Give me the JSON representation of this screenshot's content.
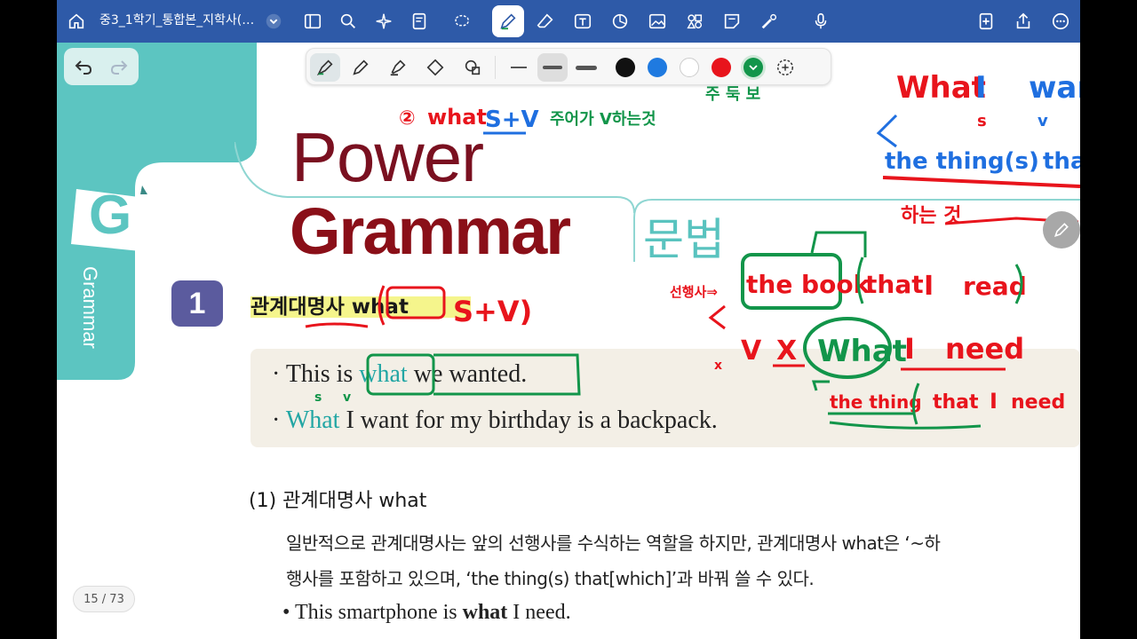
{
  "toolbar": {
    "doc_title": "중3_1학기_통합본_지학사(…",
    "icons": [
      "home-icon",
      "chevron-down-icon",
      "sidebar-icon",
      "search-icon",
      "sparkle-icon",
      "bookmark-icon",
      "lasso-icon",
      "pen-icon",
      "eraser-icon",
      "textbox-icon",
      "shape-icon",
      "image-icon",
      "elements-icon",
      "sticky-note-icon",
      "laser-icon",
      "microphone-icon",
      "add-page-icon",
      "share-icon",
      "more-icon"
    ]
  },
  "palette": {
    "tools": [
      "pen",
      "pencil",
      "highlighter",
      "eraser",
      "lasso"
    ],
    "widths": [
      "thin",
      "medium",
      "thick"
    ],
    "colors": [
      "#111111",
      "#1f7ae0",
      "#ffffff",
      "#e8141c",
      "#12954a"
    ],
    "selected_color": "#12954a"
  },
  "page": {
    "title_power": "Power",
    "title_grammar": "Grammar",
    "title_ko": "문법",
    "side_letter": "G",
    "side_label": "Grammar",
    "section_number": "1",
    "section_title": "관계대명사 what",
    "ex1_pre": "· This is ",
    "ex1_what": "what",
    "ex1_post": " we wanted.",
    "ex2_bullet": "· ",
    "ex2_what": "What",
    "ex2_post": " I want for my birthday is a backpack.",
    "sub_heading": "(1) 관계대명사 what",
    "body_line1": "일반적으로 관계대명사는 앞의 선행사를 수식하는 역할을 하지만, 관계대명사 what은 ‘~하",
    "body_line2": "행사를 포함하고 있으며, ‘the thing(s) that[which]’과 바꿔 쓸 수 있다.",
    "ex3_pre": "• This smartphone is ",
    "ex3_what": "what",
    "ex3_post": " I need.",
    "page_indicator": "15 / 73"
  },
  "annotations": {
    "top_left": [
      "②",
      "what",
      "S+V",
      "주어가 V하는것"
    ],
    "top_mid": "주 둑 보",
    "top_right": [
      "What",
      "I",
      "want",
      "s",
      "v",
      "the thing(s)",
      "that",
      "하는 것"
    ],
    "section_note": "S+V)",
    "mid_right": [
      "선행사⇒",
      "the book",
      "that",
      "I",
      "read",
      "V",
      "X",
      "What",
      "I",
      "need",
      "the thing",
      "that",
      "I",
      "need",
      "x"
    ],
    "under_is": [
      "s",
      "v"
    ]
  },
  "colors": {
    "toolbar": "#2e5aa8",
    "teal": "#59c3bf",
    "section_badge": "#5b5b9e",
    "grammar_red": "#8a0f18"
  }
}
